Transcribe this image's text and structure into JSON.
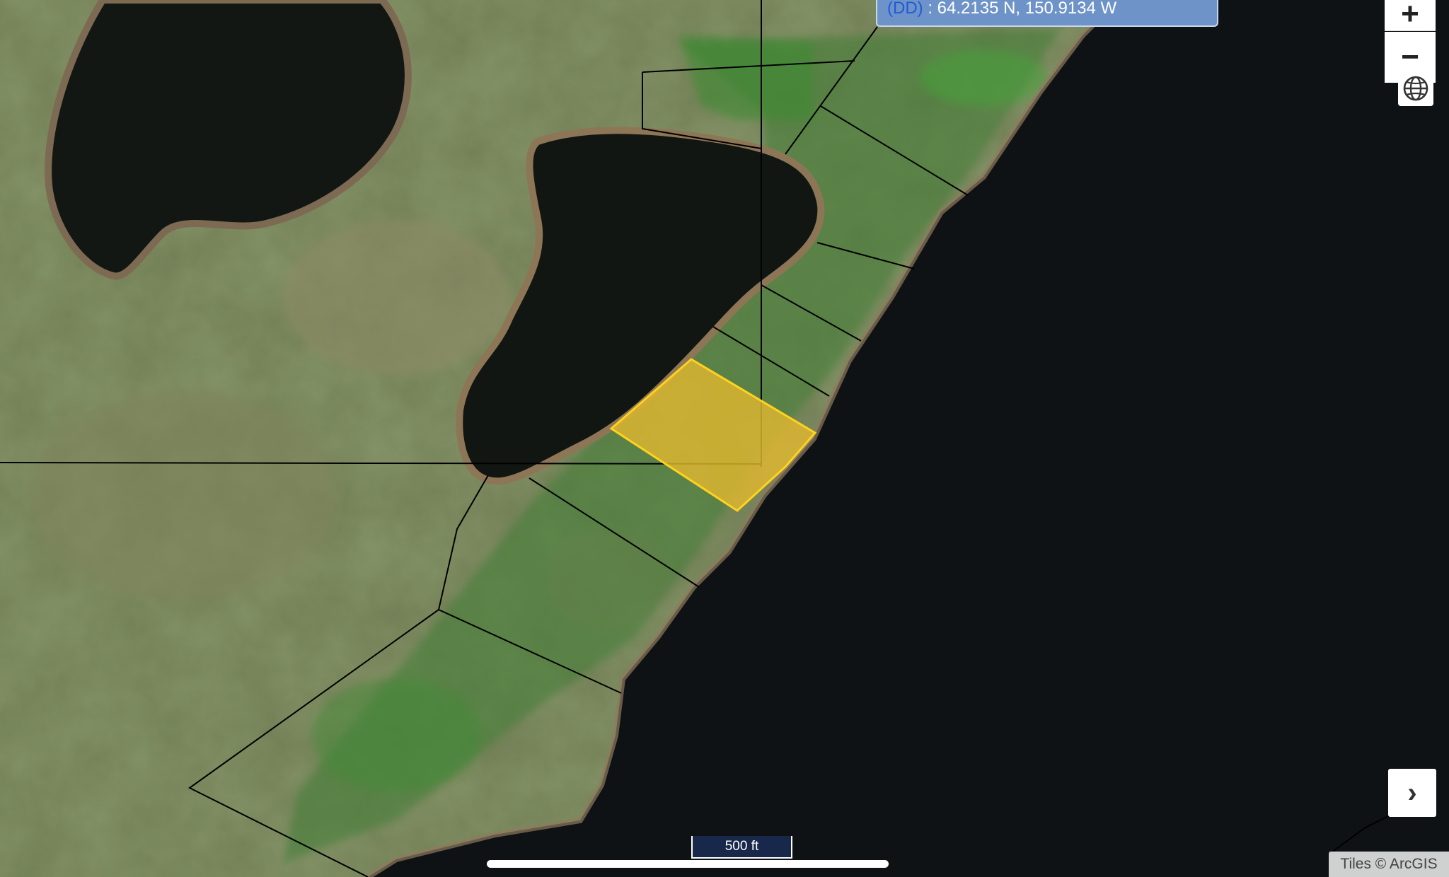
{
  "coordinates": {
    "format_label": "(DD)",
    "separator": " : ",
    "value": "64.2135 N, 150.9134 W"
  },
  "controls": {
    "zoom_in_glyph": "+",
    "zoom_out_glyph": "−",
    "globe_icon": "globe-icon",
    "expand_glyph": "›"
  },
  "scale": {
    "label": "500 ft"
  },
  "attribution": {
    "text": "Tiles © ArcGIS"
  },
  "colors": {
    "selected_parcel_fill": "#e0b730",
    "selected_parcel_stroke": "#ffd21c",
    "parcel_line": "#000000",
    "water": "#0d1114",
    "coord_panel": "#6e93c9",
    "coord_label": "#1e5bd8"
  }
}
